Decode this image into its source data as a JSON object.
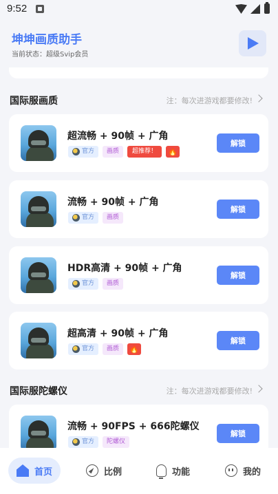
{
  "status_bar": {
    "time": "9:52"
  },
  "header": {
    "title": "坤坤画质助手",
    "subtitle": "当前状态：超级Svip会员"
  },
  "sections": [
    {
      "title": "国际服画质",
      "note": "注：每次进游戏都要修改!",
      "cards": [
        {
          "title": "超流畅 + 90帧 + 广角",
          "tags": [
            "官方",
            "画质",
            "超推荐！",
            "fire-icon"
          ],
          "button": "解锁"
        },
        {
          "title": "流畅 + 90帧 + 广角",
          "tags": [
            "官方",
            "画质"
          ],
          "button": "解锁"
        },
        {
          "title": "HDR高清 + 90帧 + 广角",
          "tags": [
            "官方",
            "画质"
          ],
          "button": "解锁"
        },
        {
          "title": "超高清 + 90帧 + 广角",
          "tags": [
            "官方",
            "画质",
            "fire-icon"
          ],
          "button": "解锁"
        }
      ]
    },
    {
      "title": "国际服陀螺仪",
      "note": "注：每次进游戏都要修改!",
      "cards": [
        {
          "title": "流畅 + 90FPS + 666陀螺仪",
          "tags": [
            "官方",
            "陀螺仪"
          ],
          "button": "解锁"
        }
      ]
    }
  ],
  "nav": [
    {
      "label": "首页",
      "icon": "home-icon",
      "active": true
    },
    {
      "label": "比例",
      "icon": "compass-icon",
      "active": false
    },
    {
      "label": "功能",
      "icon": "bulb-icon",
      "active": false
    },
    {
      "label": "我的",
      "icon": "face-icon",
      "active": false
    }
  ],
  "colors": {
    "accent": "#4a7bf5",
    "button": "#5b87f7",
    "hot_tag": "#ef4a3f",
    "background": "#f4f5f9"
  }
}
